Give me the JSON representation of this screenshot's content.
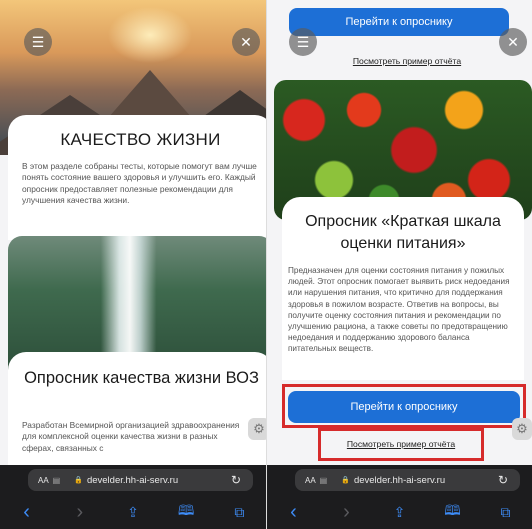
{
  "left": {
    "card1": {
      "title": "КАЧЕСТВО ЖИЗНИ",
      "text": "В этом разделе собраны тесты, которые помогут вам лучше понять состояние вашего здоровья и улучшить его. Каждый опросник предоставляет полезные рекомендации для улучшения качества жизни."
    },
    "card2": {
      "title": "Опросник качества жизни ВОЗ",
      "text": "Разработан Всемирной организацией здравоохранения для комплексной оценки качества жизни в разных сферах, связанных с"
    },
    "browser": {
      "aa": "AA",
      "url": "develder.hh-ai-serv.ru"
    }
  },
  "right": {
    "top_button": "Перейти к опроснику",
    "top_link": "Посмотреть пример отчёта",
    "card": {
      "title": "Опросник «Краткая шкала оценки питания»",
      "text": "Предназначен для оценки состояния питания у пожилых людей. Этот опросник помогает выявить риск недоедания или нарушения питания, что критично для поддержания здоровья в пожилом возрасте. Ответив на вопросы, вы получите оценку состояния питания и рекомендации по улучшению рациона, а также советы по предотвращению недоедания и поддержанию здорового баланса питательных веществ."
    },
    "main_button": "Перейти к опроснику",
    "report_link": "Посмотреть пример отчёта",
    "browser": {
      "aa": "AA",
      "url": "develder.hh-ai-serv.ru"
    }
  },
  "icons": {
    "menu": "☰",
    "close": "✕",
    "gear": "⚙",
    "lock": "🔒",
    "reload": "↻",
    "back": "‹",
    "forward": "›",
    "share": "⇪",
    "bookmarks": "🕮",
    "tabs": "⧉",
    "reader": "▤"
  },
  "colors": {
    "accent": "#1d6fd6",
    "highlight": "#d62b2b"
  }
}
